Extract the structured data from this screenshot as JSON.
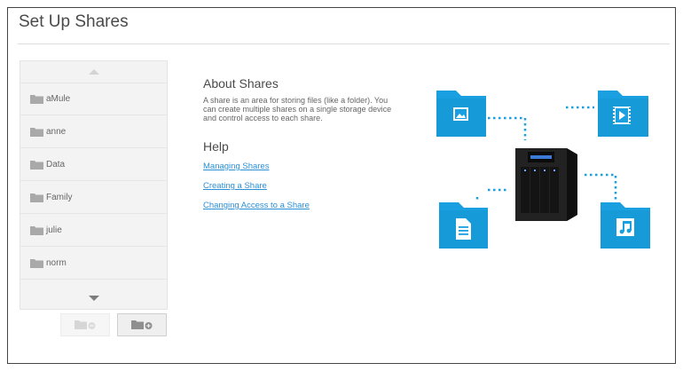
{
  "page": {
    "title": "Set Up Shares"
  },
  "shares": {
    "items": [
      {
        "label": "aMule"
      },
      {
        "label": "anne"
      },
      {
        "label": "Data"
      },
      {
        "label": "Family"
      },
      {
        "label": "julie"
      },
      {
        "label": "norm"
      }
    ]
  },
  "about": {
    "title": "About Shares",
    "text": "A share is an area for storing files (like a folder). You can create multiple shares on a single storage device and control access to each share."
  },
  "help": {
    "title": "Help",
    "links": [
      {
        "label": "Managing Shares"
      },
      {
        "label": "Creating a Share"
      },
      {
        "label": "Changing Access to a Share"
      }
    ]
  },
  "colors": {
    "accent": "#1aa0e0",
    "link": "#2a8fd4",
    "folder_icon": "#a9a9a9"
  },
  "icons": {
    "list_scroll_up": "chevron-up-icon",
    "list_scroll_down": "chevron-down-icon",
    "share_item": "folder-icon",
    "remove_share": "folder-remove-icon",
    "add_share": "folder-add-icon"
  }
}
